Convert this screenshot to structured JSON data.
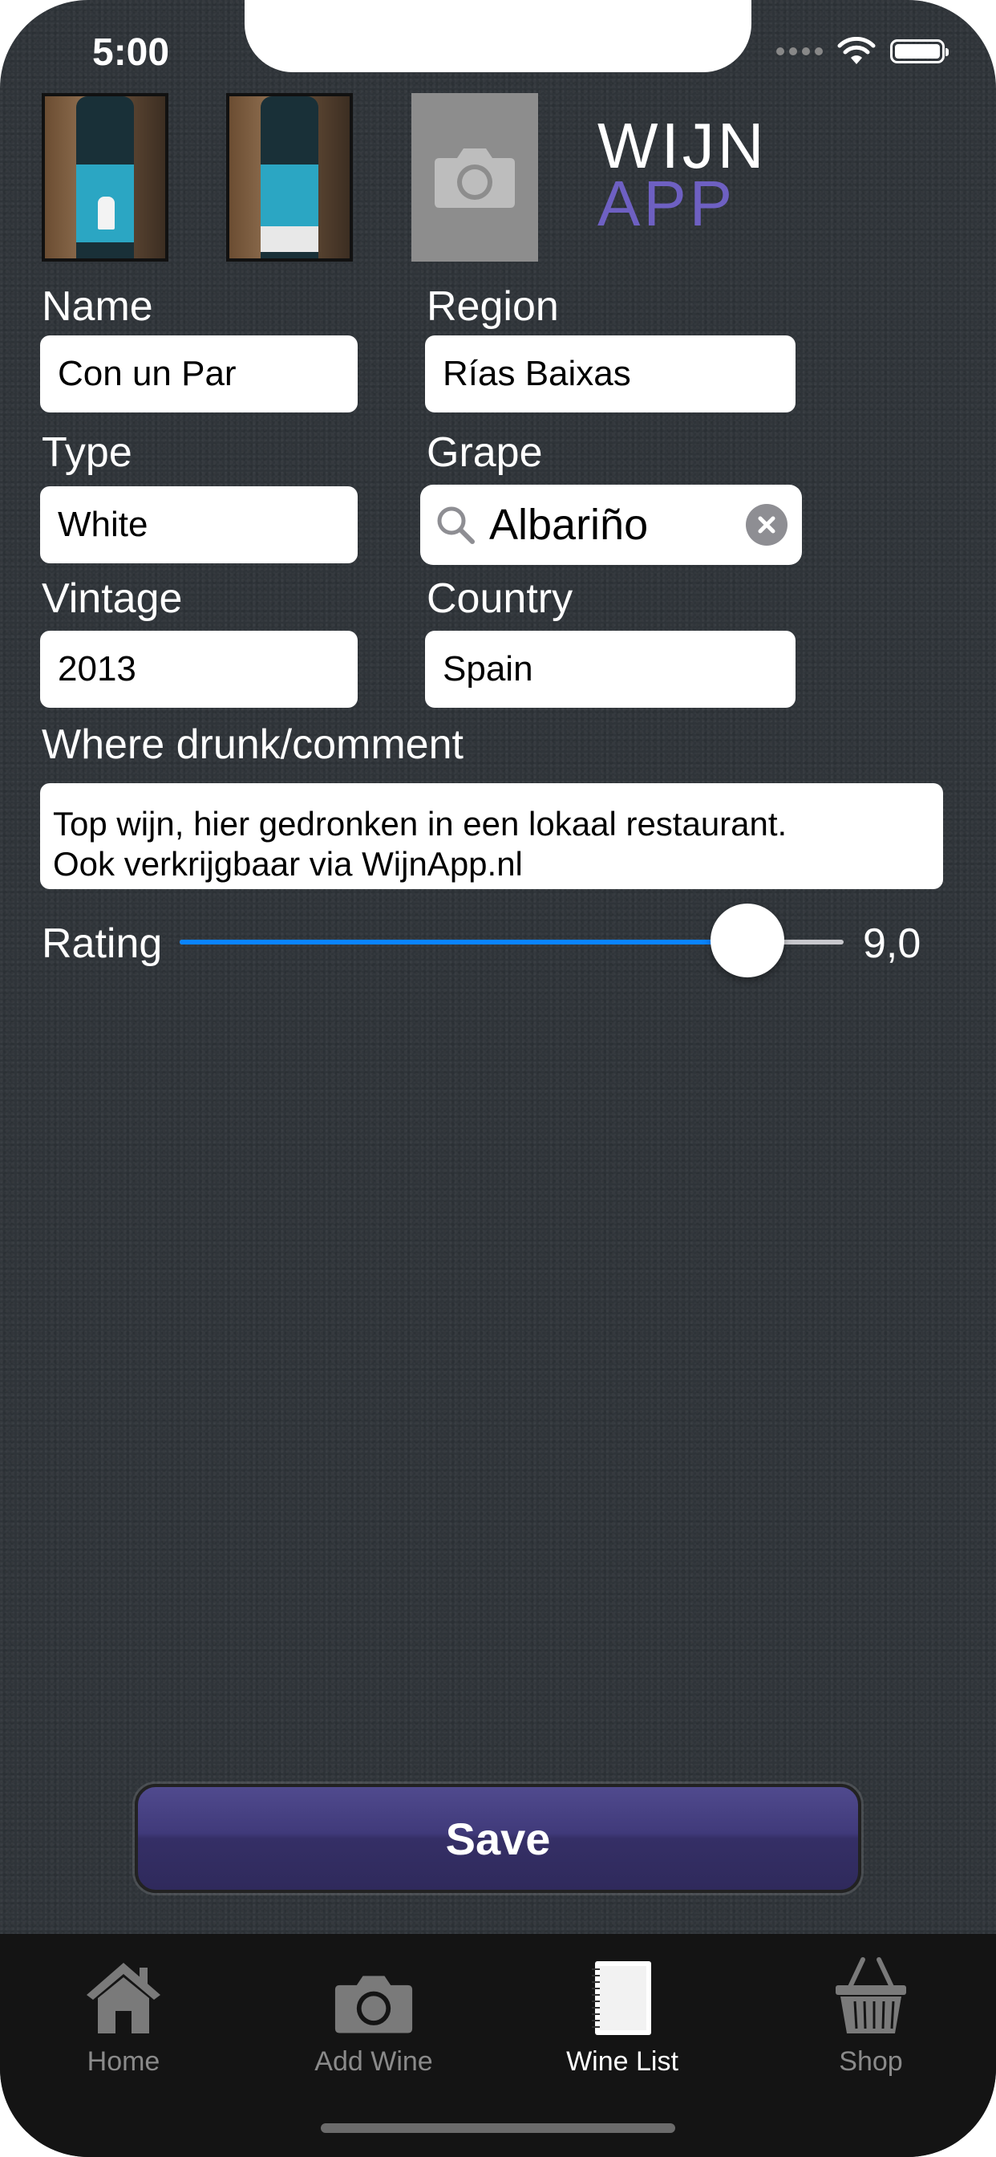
{
  "status": {
    "time": "5:00"
  },
  "logo": {
    "line1": "WIJN",
    "line2": "APP",
    "line1_color": "#ffffff",
    "line2_color": "#6e60c2"
  },
  "photos": [
    {
      "kind": "front-label-photo"
    },
    {
      "kind": "back-label-photo"
    },
    {
      "kind": "camera-placeholder",
      "icon": "camera-icon"
    }
  ],
  "form": {
    "name": {
      "label": "Name",
      "value": "Con un Par"
    },
    "region": {
      "label": "Region",
      "value": "Rías Baixas"
    },
    "type": {
      "label": "Type",
      "value": "White"
    },
    "grape": {
      "label": "Grape",
      "value": "Albariño"
    },
    "vintage": {
      "label": "Vintage",
      "value": "2013"
    },
    "country": {
      "label": "Country",
      "value": "Spain"
    },
    "comment": {
      "label": "Where drunk/comment",
      "line1": "Top wijn, hier gedronken in een lokaal restaurant.",
      "line2": "Ook verkrijgbaar via WijnApp.nl"
    },
    "rating": {
      "label": "Rating",
      "value_text": "9,0",
      "value": 9.0,
      "max": 10,
      "accent_color": "#0a84ff"
    }
  },
  "save": {
    "label": "Save"
  },
  "tabbar": {
    "items": [
      {
        "label": "Home",
        "icon": "home-icon",
        "active": false
      },
      {
        "label": "Add Wine",
        "icon": "camera-icon",
        "active": false
      },
      {
        "label": "Wine List",
        "icon": "notebook-icon",
        "active": true
      },
      {
        "label": "Shop",
        "icon": "basket-icon",
        "active": false
      }
    ]
  }
}
